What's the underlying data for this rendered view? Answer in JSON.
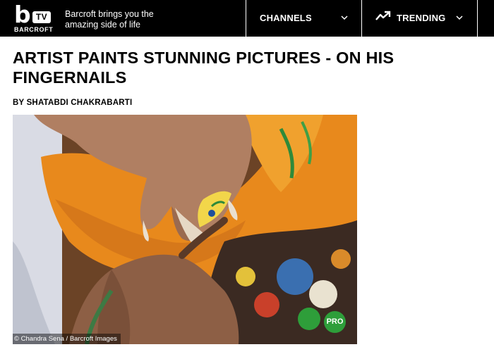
{
  "header": {
    "logo_letter": "b",
    "logo_badge": "TV",
    "logo_word": "BARCROFT",
    "tagline": "Barcroft brings you the amazing side of life",
    "nav": {
      "channels_label": "CHANNELS",
      "trending_label": "TRENDING"
    }
  },
  "article": {
    "headline": "ARTIST PAINTS STUNNING PICTURES - ON HIS FINGERNAILS",
    "byline": "BY SHATABDI CHAKRABARTI",
    "image": {
      "badge": "PRO",
      "credit": "© Chandra Sena / Barcroft Images"
    }
  },
  "colors": {
    "topbar": "#000000",
    "pro_badge": "#2e9e3a",
    "cloth": "#e8891c"
  },
  "icons": [
    "chevron-down-icon",
    "trending-icon"
  ]
}
